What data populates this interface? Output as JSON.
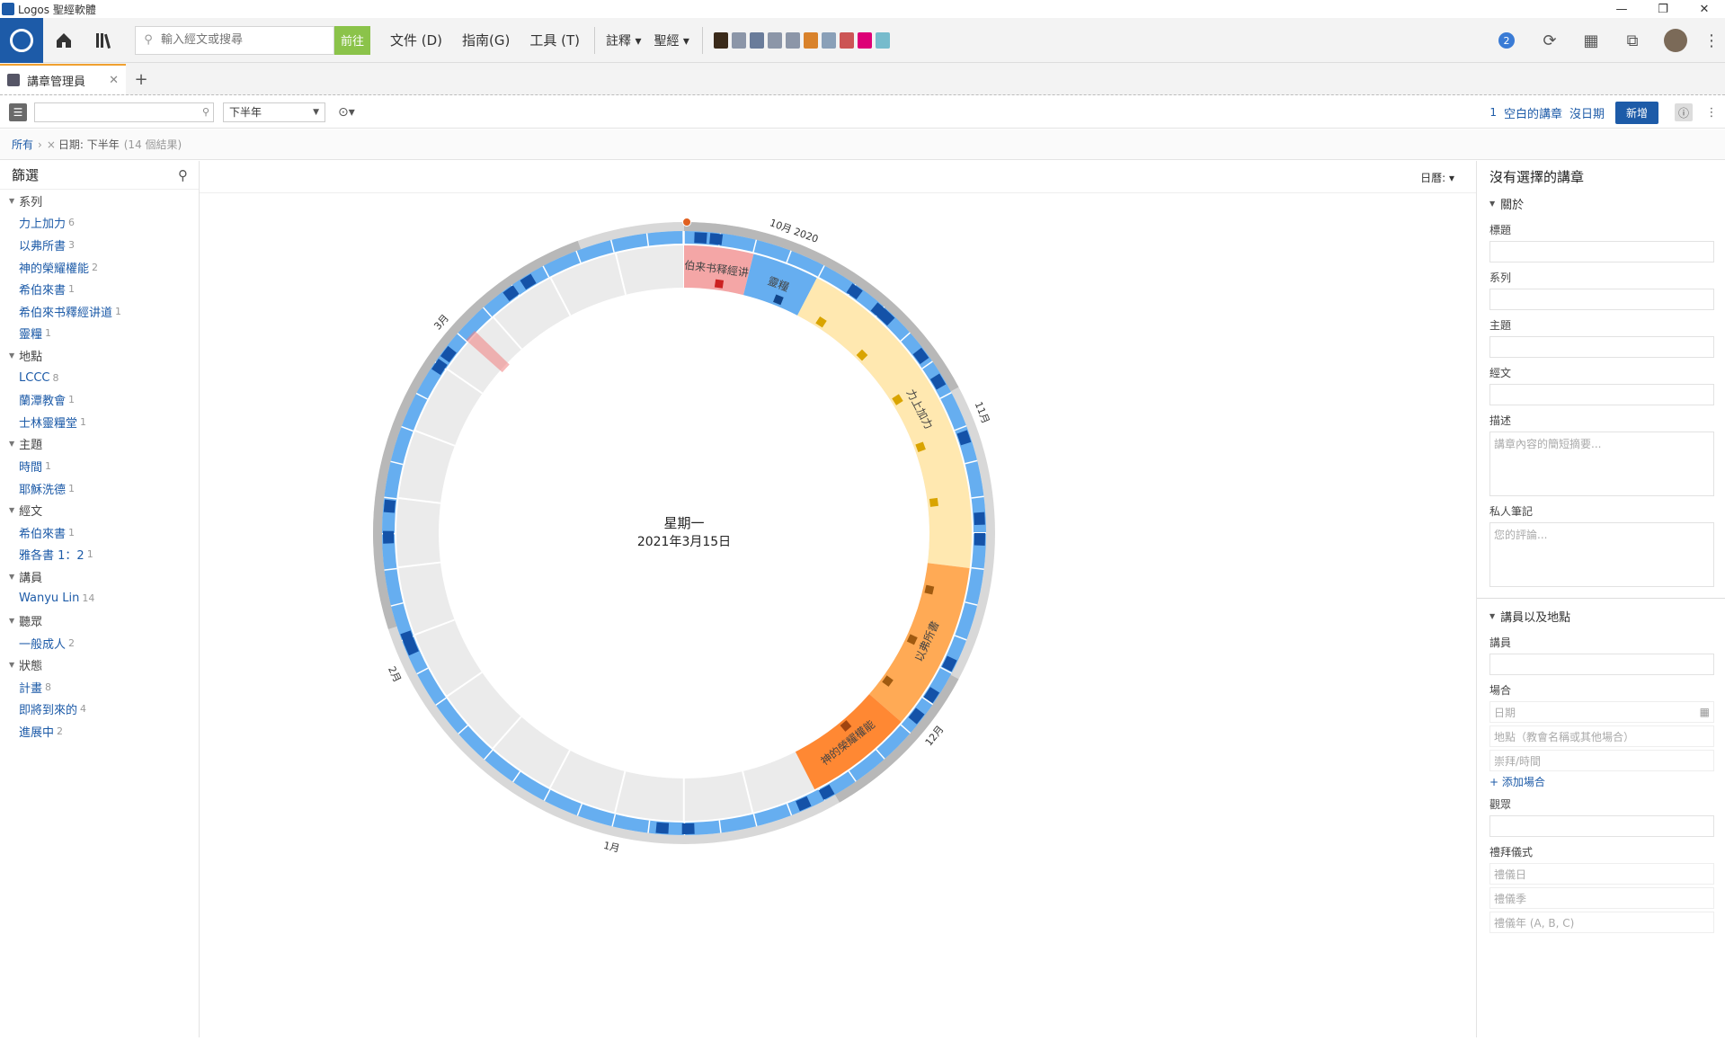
{
  "titlebar": {
    "title": "Logos 聖經軟體",
    "minimize": "—",
    "restore": "❐",
    "close": "✕"
  },
  "toolbar": {
    "search_placeholder": "輸入經文或搜尋",
    "go_label": "前往",
    "menus": [
      "文件 (D)",
      "指南(G)",
      "工具 (T)"
    ],
    "dropdowns": [
      "註釋",
      "聖經"
    ],
    "notification_count": "2"
  },
  "tabs": [
    {
      "label": "講章管理員",
      "close": "✕"
    }
  ],
  "tab_add": "+",
  "panel_toolbar": {
    "filter_placeholder": "",
    "period_select": "下半年",
    "count": "1",
    "empty_sermon_link": "空白的講章",
    "no_date_link": "沒日期",
    "new_button": "新增"
  },
  "breadcrumb": {
    "all": "所有",
    "separator": "›",
    "remove": "×",
    "filter": "日期: 下半年",
    "results": "(14 個結果)"
  },
  "sidebar": {
    "title": "篩選",
    "groups": [
      {
        "label": "系列",
        "items": [
          {
            "label": "力上加力",
            "count": "6"
          },
          {
            "label": "以弗所書",
            "count": "3"
          },
          {
            "label": "神的榮耀權能",
            "count": "2"
          },
          {
            "label": "希伯來書",
            "count": "1"
          },
          {
            "label": "希伯來书釋經讲道",
            "count": "1"
          },
          {
            "label": "靈糧",
            "count": "1"
          }
        ]
      },
      {
        "label": "地點",
        "items": [
          {
            "label": "LCCC",
            "count": "8"
          },
          {
            "label": "蘭潭教會",
            "count": "1"
          },
          {
            "label": "士林靈糧堂",
            "count": "1"
          }
        ]
      },
      {
        "label": "主題",
        "items": [
          {
            "label": "時間",
            "count": "1"
          },
          {
            "label": "耶穌洗德",
            "count": "1"
          }
        ]
      },
      {
        "label": "經文",
        "items": [
          {
            "label": "希伯來書",
            "count": "1"
          },
          {
            "label": "雅各書 1：2",
            "count": "1"
          }
        ]
      },
      {
        "label": "講員",
        "items": [
          {
            "label": "Wanyu Lin",
            "count": "14"
          }
        ]
      },
      {
        "label": "聽眾",
        "items": [
          {
            "label": "一般成人",
            "count": "2"
          }
        ]
      },
      {
        "label": "狀態",
        "items": [
          {
            "label": "計畫",
            "count": "8"
          },
          {
            "label": "即將到來的",
            "count": "4"
          },
          {
            "label": "進展中",
            "count": "2"
          }
        ]
      }
    ]
  },
  "main": {
    "view_dropdown": "日曆: ▾",
    "center_weekday": "星期一",
    "center_date": "2021年3月15日",
    "month_labels": [
      "10月 2020",
      "11月",
      "12月",
      "1月",
      "2月",
      "3月"
    ],
    "series_segments": [
      {
        "label": "伯来书释經讲",
        "color": "#f4a6a6",
        "marker": "#cc2222"
      },
      {
        "label": "靈糧",
        "color": "#66aef0",
        "marker": "#114488"
      },
      {
        "label": "力上加力",
        "color": "#ffe8b0",
        "marker": "#d9a400"
      },
      {
        "label": "以弗所書",
        "color": "#ffaa55",
        "marker": "#a05a10"
      },
      {
        "label": "神的榮耀權能",
        "color": "#ff8833",
        "marker": "#a04410"
      }
    ]
  },
  "right_panel": {
    "title": "沒有選擇的講章",
    "about_section": "關於",
    "fields": [
      {
        "label": "標題",
        "placeholder": ""
      },
      {
        "label": "系列",
        "placeholder": ""
      },
      {
        "label": "主題",
        "placeholder": ""
      },
      {
        "label": "經文",
        "placeholder": ""
      }
    ],
    "description_label": "描述",
    "description_placeholder": "講章內容的簡短摘要...",
    "notes_label": "私人筆記",
    "notes_placeholder": "您的評論...",
    "speaker_section": "講員以及地點",
    "speaker_label": "講員",
    "occasion_label": "場合",
    "date_placeholder": "日期",
    "location_placeholder": "地點（教會名稱或其他場合）",
    "service_placeholder": "崇拜/時間",
    "add_occasion": "+ 添加場合",
    "audience_label": "觀眾",
    "liturgy_label": "禮拜儀式",
    "liturgy_day": "禮儀日",
    "liturgy_season": "禮儀季",
    "liturgy_year": "禮儀年 (A, B, C)"
  }
}
